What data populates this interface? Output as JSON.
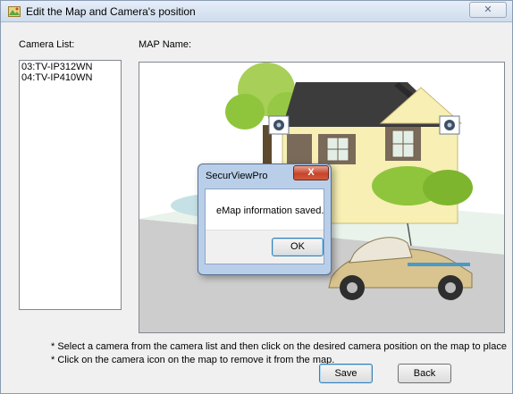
{
  "window": {
    "title": "Edit the Map and Camera's position",
    "close_symbol": "✕"
  },
  "labels": {
    "camera_list": "Camera List:",
    "map_name": "MAP Name:"
  },
  "camera_list": {
    "items": [
      {
        "label": "03:TV-IP312WN"
      },
      {
        "label": "04:TV-IP410WN"
      }
    ]
  },
  "notes": [
    "* Select a camera from the camera list and then click on the desired camera position on the map to place the ca",
    "* Click on the camera icon on the map to remove it from the map."
  ],
  "buttons": {
    "save": "Save",
    "back": "Back"
  },
  "dialog": {
    "title": "SecurViewPro",
    "close_symbol": "X",
    "message": "eMap information saved.",
    "ok": "OK"
  },
  "icons": {
    "title_icon": "map-window-icon",
    "camera_marker": "camera-icon"
  },
  "colors": {
    "house_wall": "#f7efb4",
    "roof": "#3c3c3c",
    "tree": "#8fc53c",
    "ground": "#cfcfcf",
    "sky": "#cfe6e8",
    "car_body": "#d9c48f"
  }
}
